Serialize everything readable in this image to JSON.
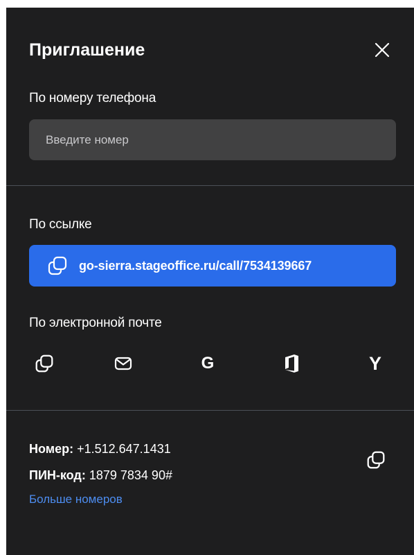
{
  "dialog": {
    "title": "Приглашение"
  },
  "phone": {
    "label": "По номеру телефона",
    "placeholder": "Введите номер",
    "value": ""
  },
  "link": {
    "label": "По ссылке",
    "url": "go-sierra.stageoffice.ru/call/7534139667"
  },
  "email": {
    "label": "По электронной почте",
    "options": [
      {
        "icon": "copy-icon"
      },
      {
        "icon": "mail-icon"
      },
      {
        "icon": "google-icon",
        "glyph": "G"
      },
      {
        "icon": "office-icon"
      },
      {
        "icon": "yandex-icon",
        "glyph": "Y"
      }
    ]
  },
  "dial_in": {
    "number_label": "Номер:",
    "number_value": "+1.512.647.1431",
    "pin_label": "ПИН-код:",
    "pin_value": "1879 7834 90#",
    "more_numbers": "Больше номеров"
  },
  "colors": {
    "panel_bg": "#1e1e1f",
    "input_bg": "#414142",
    "accent": "#2a6cea",
    "link": "#4d8df0",
    "divider": "#4c5057"
  }
}
